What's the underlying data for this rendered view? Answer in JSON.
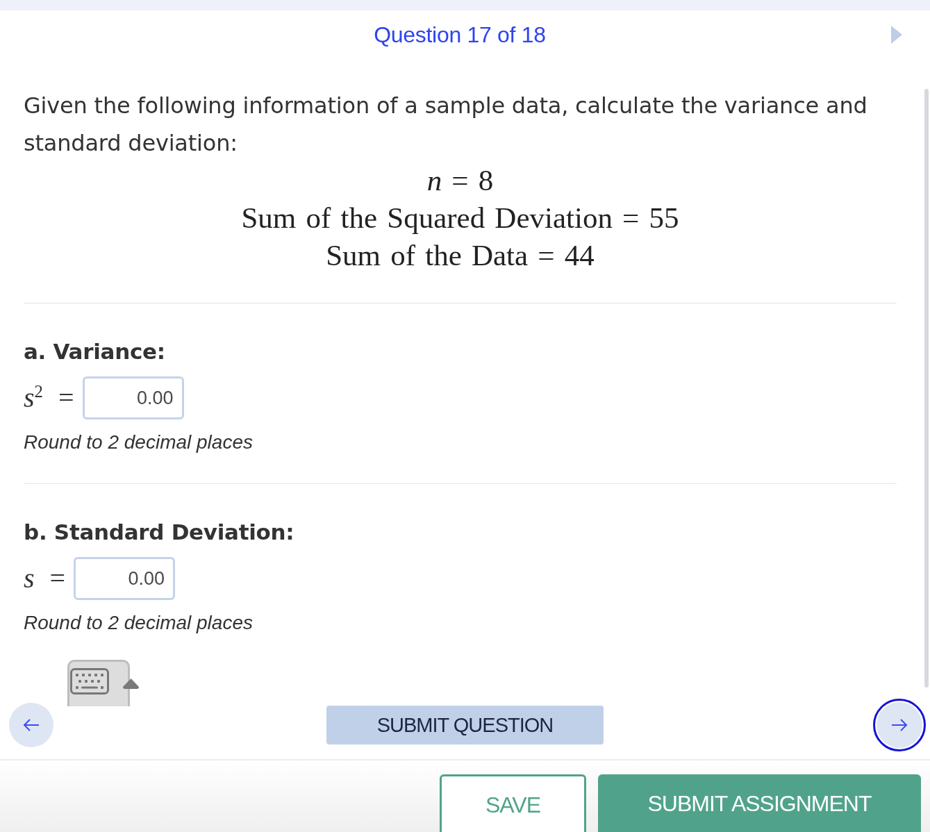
{
  "header": {
    "title": "Question 17 of 18"
  },
  "question": {
    "prompt": "Given the following information of a sample data, calculate the variance and standard deviation:",
    "givens": [
      "*n* = 8",
      "Sum of the Squared Deviation = 55",
      "Sum of the Data = 44"
    ]
  },
  "parts": [
    {
      "heading": "a. Variance:",
      "equation": "*s*$^{2}$ =",
      "answer": {
        "value": "0.00"
      },
      "hint": "Round to 2 decimal places"
    },
    {
      "heading": "b. Standard Deviation:",
      "equation": "*s* =",
      "answer": {
        "value": "0.00"
      },
      "hint": "Round to 2 decimal places"
    }
  ],
  "navigation": [
    {
      "kind": "previous",
      "focused": false
    },
    {
      "kind": "next",
      "focused": true
    }
  ],
  "submit_question": {
    "label": "SUBMIT QUESTION"
  },
  "footer": {
    "buttons": [
      {
        "label": "SAVE",
        "kind": "outline"
      },
      {
        "label": "SUBMIT ASSIGNMENT",
        "kind": "filled"
      }
    ]
  }
}
